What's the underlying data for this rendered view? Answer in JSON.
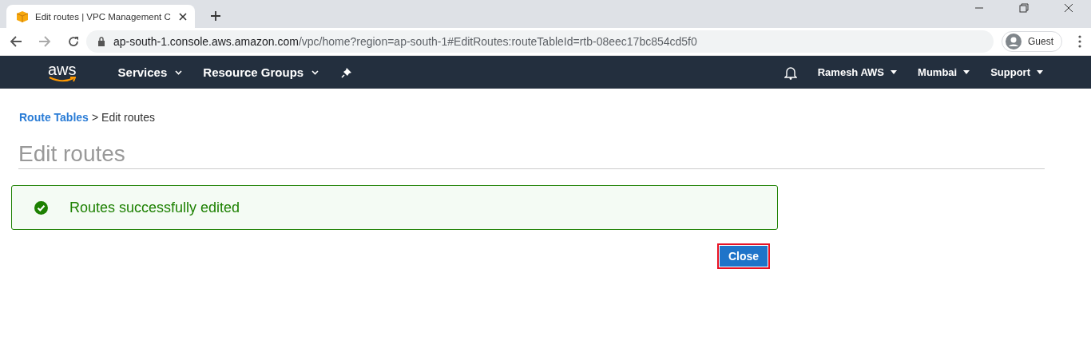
{
  "browser": {
    "tab_title": "Edit routes | VPC Management C",
    "url_host": "ap-south-1.console.aws.amazon.com",
    "url_path": "/vpc/home?region=ap-south-1#EditRoutes:routeTableId=rtb-08eec17bc854cd5f0",
    "profile": "Guest"
  },
  "navbar": {
    "logo": "aws",
    "menus": [
      "Services",
      "Resource Groups"
    ],
    "right_menus": [
      "Ramesh AWS",
      "Mumbai",
      "Support"
    ]
  },
  "breadcrumb": {
    "link": "Route Tables",
    "separator": ">",
    "current": "Edit routes"
  },
  "page_title": "Edit routes",
  "alert": {
    "kind": "success",
    "message": "Routes successfully edited"
  },
  "close_button": {
    "label": "Close",
    "highlighted": true
  }
}
